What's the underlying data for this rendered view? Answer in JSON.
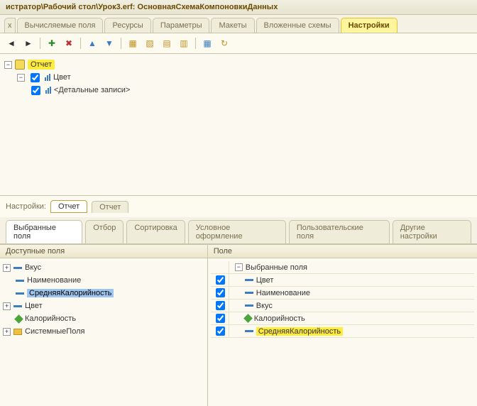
{
  "title": "истратор\\Рабочий стол\\Урок3.erf: ОсновнаяСхемаКомпоновкиДанных",
  "top_tabs": {
    "stub": "х",
    "items": [
      "Вычисляемые поля",
      "Ресурсы",
      "Параметры",
      "Макеты",
      "Вложенные схемы",
      "Настройки"
    ]
  },
  "tree": {
    "root": "Отчет",
    "level1": "Цвет",
    "level2": "<Детальные записи>"
  },
  "settings_row": {
    "label": "Настройки:",
    "tab1": "Отчет",
    "tab2": "Отчет"
  },
  "sub_tabs": [
    "Выбранные поля",
    "Отбор",
    "Сортировка",
    "Условное оформление",
    "Пользовательские поля",
    "Другие настройки"
  ],
  "left": {
    "header": "Доступные поля",
    "items": [
      "Вкус",
      "Наименование",
      "СредняяКалорийность",
      "Цвет",
      "Калорийность",
      "СистемныеПоля"
    ]
  },
  "right": {
    "header": "Поле",
    "group": "Выбранные поля",
    "items": [
      "Цвет",
      "Наименование",
      "Вкус",
      "Калорийность",
      "СредняяКалорийность"
    ]
  }
}
